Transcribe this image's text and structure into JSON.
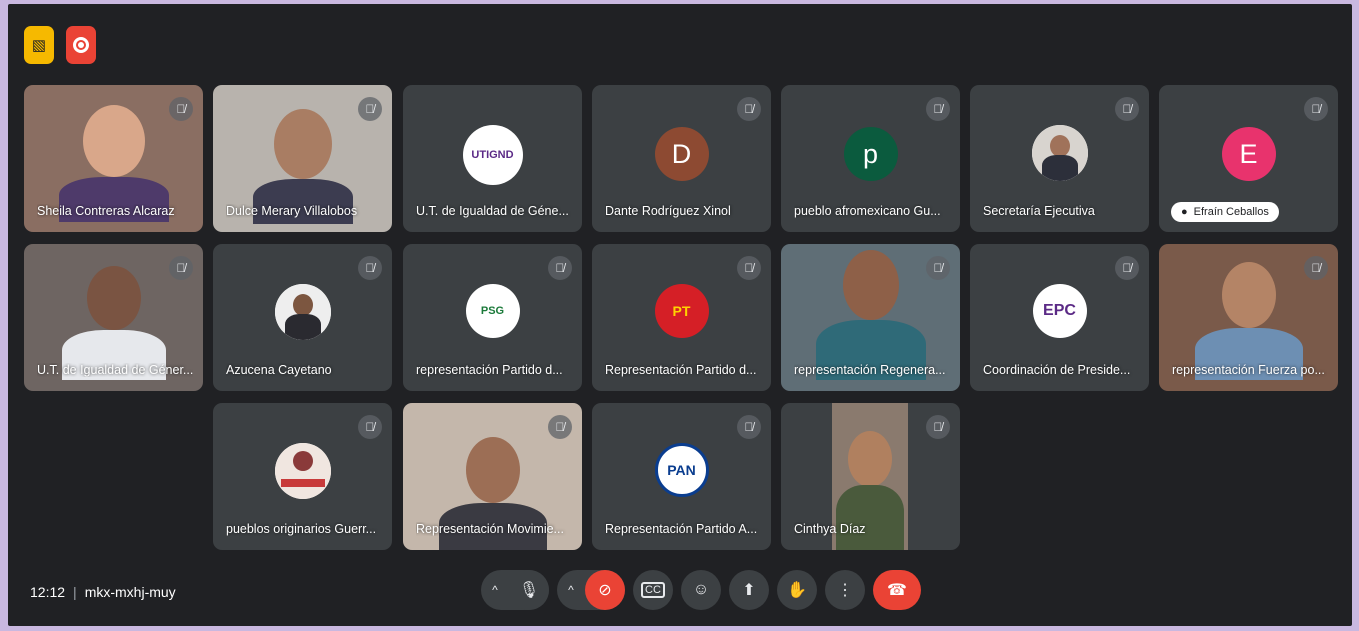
{
  "meeting": {
    "time": "12:12",
    "code": "mkx-mxhj-muy"
  },
  "colors": {
    "background": "#202124",
    "tile": "#3c4043",
    "accent_red": "#ea4335",
    "accent_yellow": "#f6b900"
  },
  "participants": [
    {
      "name": "Sheila Contreras Alcaraz"
    },
    {
      "name": "Dulce Merary Villalobos"
    },
    {
      "name": "U.T. de Igualdad de Géne...",
      "logo": "UTIGND"
    },
    {
      "name": "Dante Rodríguez Xinol",
      "initial": "D"
    },
    {
      "name": "pueblo afromexicano Gu...",
      "initial": "p"
    },
    {
      "name": "Secretaría Ejecutiva"
    },
    {
      "name": "Efraín Ceballos",
      "initial": "E"
    },
    {
      "name": "U.T. de Igualdad de Géner..."
    },
    {
      "name": "Azucena Cayetano"
    },
    {
      "name": "representación Partido d...",
      "logo": "PSG"
    },
    {
      "name": "Representación Partido d...",
      "logo": "PT"
    },
    {
      "name": "representación Regenera..."
    },
    {
      "name": "Coordinación de Preside...",
      "logo": "EPC"
    },
    {
      "name": "representación Fuerza po..."
    },
    {
      "name": "pueblos originarios Guerr..."
    },
    {
      "name": "Representación Movimie..."
    },
    {
      "name": "Representación Partido A...",
      "logo": "PAN"
    },
    {
      "name": "Cinthya Díaz"
    }
  ],
  "icons": {
    "mute": "mic-off-icon",
    "mic": "mic-icon",
    "camera_off": "videocam-off-icon",
    "captions": "captions-icon",
    "emoji": "emoji-icon",
    "present": "present-icon",
    "hand": "raise-hand-icon",
    "more": "more-icon",
    "hangup": "call-end-icon",
    "expand": "chevron-up-icon"
  }
}
